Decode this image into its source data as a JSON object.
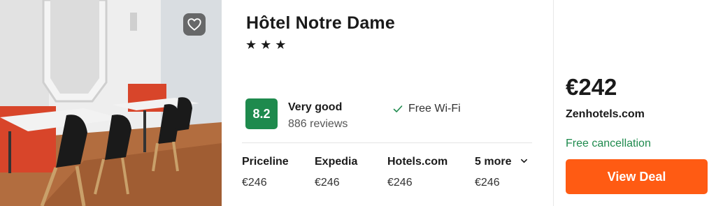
{
  "hotel": {
    "name": "Hôtel Notre Dame",
    "stars": "★★★",
    "photo_alt": "Hotel dining room",
    "favorite_icon": "heart-icon"
  },
  "rating": {
    "score": "8.2",
    "label": "Very good",
    "reviews": "886 reviews"
  },
  "amenity": {
    "icon": "check-icon",
    "label": "Free Wi-Fi"
  },
  "providers": [
    {
      "name": "Priceline",
      "price": "€246"
    },
    {
      "name": "Expedia",
      "price": "€246"
    },
    {
      "name": "Hotels.com",
      "price": "€246"
    },
    {
      "name": "5 more",
      "price": "€246"
    }
  ],
  "deal": {
    "price": "€242",
    "site": "Zenhotels.com",
    "cancellation": "Free cancellation",
    "button_label": "View Deal"
  },
  "colors": {
    "score_bg": "#1e8a4d",
    "cancellation_text": "#1e8a4d",
    "cta": "#ff5b13"
  }
}
